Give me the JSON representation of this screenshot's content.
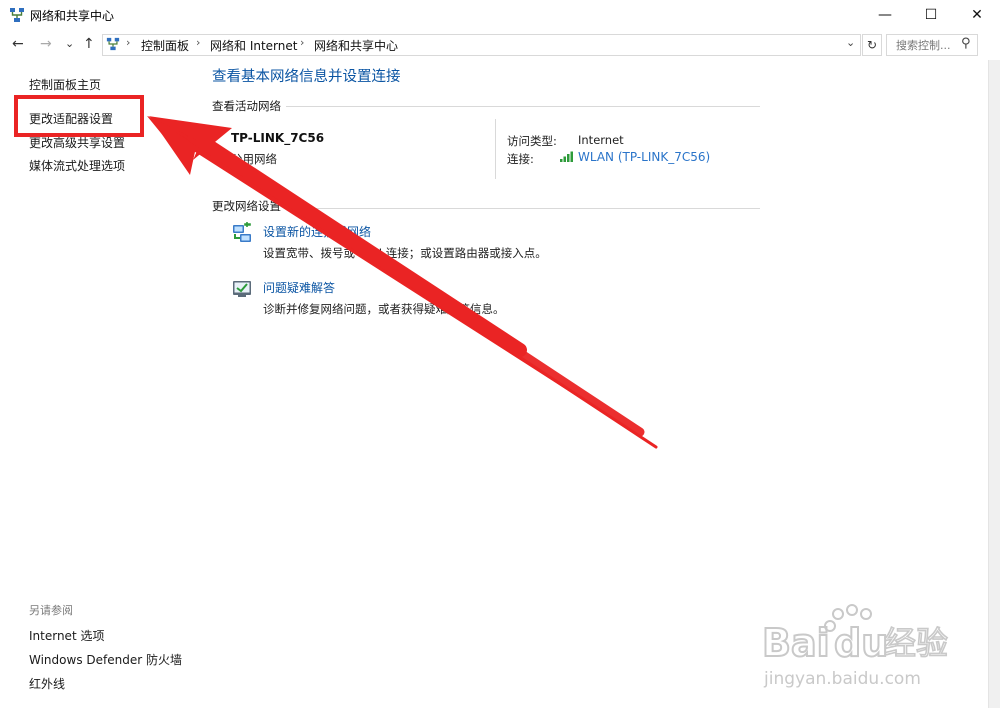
{
  "window": {
    "title": "网络和共享中心",
    "controls": {
      "minimize": "—",
      "maximize": "☐",
      "close": "✕"
    }
  },
  "nav": {
    "back": "←",
    "forward": "→",
    "recent": "⌄",
    "up": "↑"
  },
  "address": {
    "crumbs": [
      "控制面板",
      "网络和 Internet",
      "网络和共享中心"
    ],
    "separator": "›",
    "dropdown": "⌄",
    "refresh": "↻"
  },
  "search": {
    "placeholder": "搜索控制...",
    "icon": "⚲"
  },
  "left_pane": {
    "links": [
      "控制面板主页",
      "更改适配器设置",
      "更改高级共享设置",
      "媒体流式处理选项"
    ],
    "see_also_title": "另请参阅",
    "see_also": [
      "Internet 选项",
      "Windows Defender 防火墙",
      "红外线"
    ]
  },
  "main": {
    "title": "查看基本网络信息并设置连接",
    "active_networks_label": "查看活动网络",
    "network": {
      "name": "TP-LINK_7C56",
      "type": "公用网络",
      "access_type_label": "访问类型:",
      "access_type_value": "Internet",
      "connection_label": "连接:",
      "connection_value": "WLAN (TP-LINK_7C56)"
    },
    "change_settings_label": "更改网络设置",
    "tasks": [
      {
        "title": "设置新的连接或网络",
        "desc": "设置宽带、拨号或 VPN 连接；或设置路由器或接入点。",
        "icon": "network-setup-icon"
      },
      {
        "title": "问题疑难解答",
        "desc": "诊断并修复网络问题，或者获得疑难解答信息。",
        "icon": "troubleshoot-icon"
      }
    ]
  },
  "watermark": {
    "brand_latin": "Bai",
    "brand_du": "du",
    "brand_cn": "经验",
    "url": "jingyan.baidu.com"
  },
  "colors": {
    "link": "#0b55a3",
    "annotation_red": "#ea2424"
  }
}
